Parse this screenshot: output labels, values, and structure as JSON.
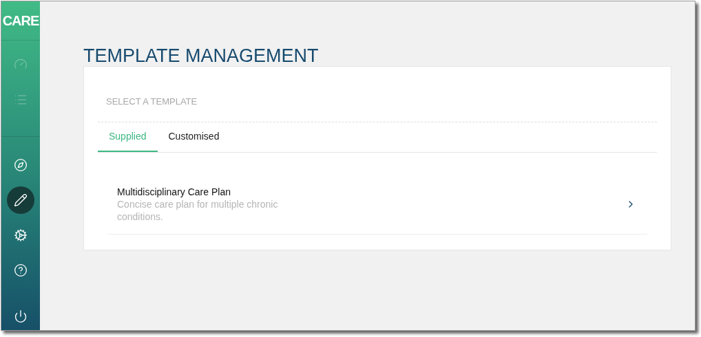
{
  "sidebar": {
    "logo": "CARE",
    "top_items": [
      {
        "kind": "dashboard",
        "disabled": true
      },
      {
        "kind": "list",
        "disabled": true
      }
    ],
    "bottom_items": [
      {
        "kind": "compass",
        "selected": false
      },
      {
        "kind": "edit",
        "selected": true
      },
      {
        "kind": "settings",
        "selected": false
      },
      {
        "kind": "help",
        "selected": false
      },
      {
        "kind": "power",
        "selected": false
      }
    ]
  },
  "page_title": "TEMPLATE MANAGEMENT",
  "card": {
    "heading": "SELECT A TEMPLATE",
    "tabs": [
      {
        "label": "Supplied",
        "selected": true
      },
      {
        "label": "Customised",
        "selected": false
      }
    ],
    "templates": [
      {
        "title": "Multidisciplinary Care Plan",
        "description": "Concise care plan for multiple chronic conditions."
      }
    ]
  }
}
